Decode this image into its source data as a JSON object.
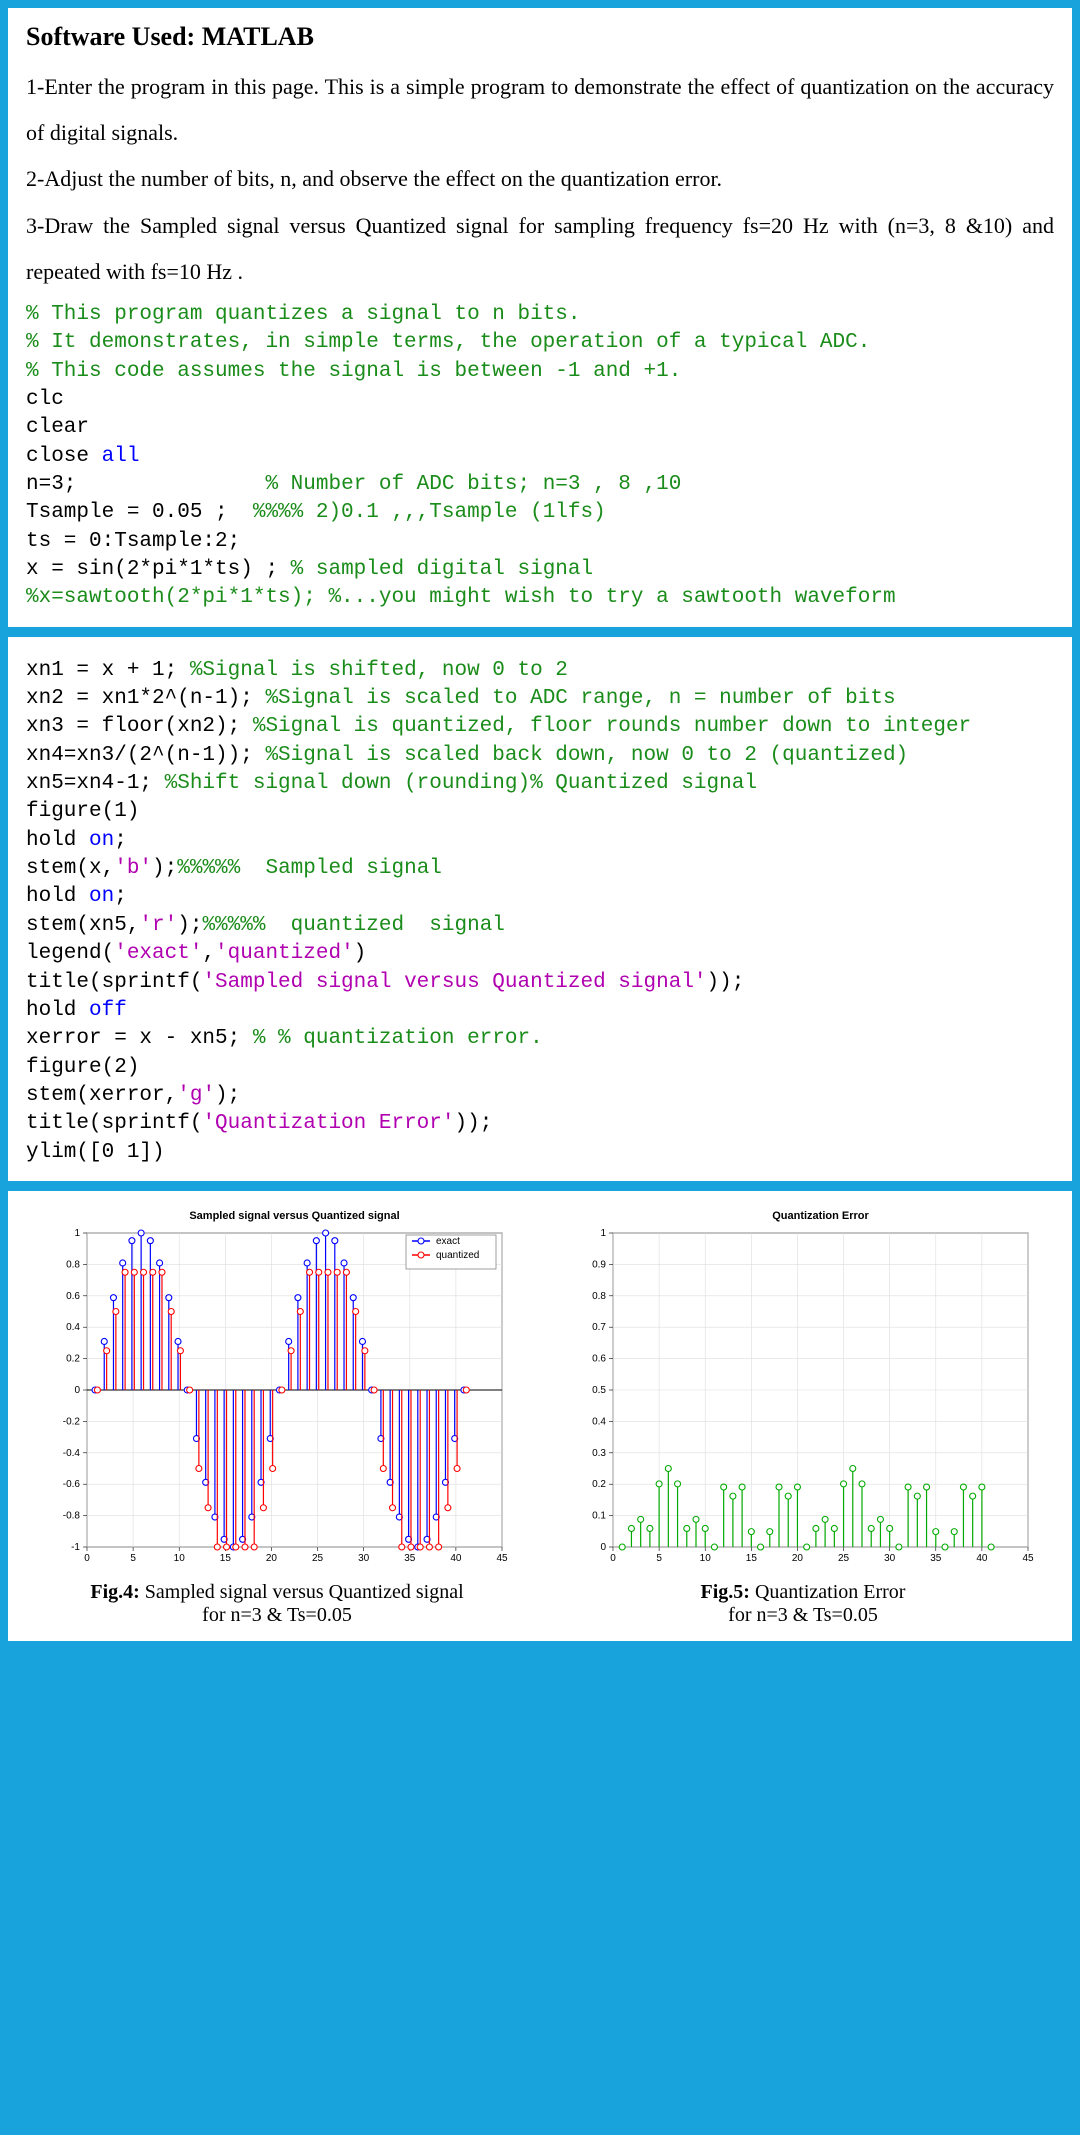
{
  "header": {
    "title": "Software Used: MATLAB"
  },
  "instructions": {
    "p1": "1-Enter the program in this page. This is a simple program to demonstrate  the effect of quantization on the accuracy of digital signals.",
    "p2": " 2-Adjust the number of bits, n, and observe the effect on the quantization error.",
    "p3": "3-Draw the Sampled signal versus Quantized signal for sampling frequency fs=20 Hz with (n=3, 8 &10) and repeated with fs=10 Hz ."
  },
  "code1": [
    {
      "t": "g",
      "s": "% This program quantizes a signal to n bits."
    },
    {
      "t": "g",
      "s": "% It demonstrates, in simple terms, the operation of a typical ADC."
    },
    {
      "t": "g",
      "s": "% This code assumes the signal is between -1 and +1."
    },
    {
      "t": "k",
      "s": "clc"
    },
    {
      "t": "k",
      "s": "clear"
    },
    {
      "t": "mix",
      "parts": [
        {
          "t": "k",
          "s": "close "
        },
        {
          "t": "b",
          "s": "all"
        }
      ]
    },
    {
      "t": "mix",
      "parts": [
        {
          "t": "k",
          "s": "n=3;               "
        },
        {
          "t": "g",
          "s": "% Number of ADC bits; n=3 , 8 ,10"
        }
      ]
    },
    {
      "t": "mix",
      "parts": [
        {
          "t": "k",
          "s": "Tsample = 0.05 ;  "
        },
        {
          "t": "g",
          "s": "%%%% 2)0.1 ,,,Tsample (1lfs)"
        }
      ]
    },
    {
      "t": "k",
      "s": "ts = 0:Tsample:2;"
    },
    {
      "t": "mix",
      "parts": [
        {
          "t": "k",
          "s": "x = sin(2*pi*1*ts) ; "
        },
        {
          "t": "g",
          "s": "% sampled digital signal"
        }
      ]
    },
    {
      "t": "g",
      "s": "%x=sawtooth(2*pi*1*ts); %...you might wish to try a sawtooth waveform"
    }
  ],
  "code2": [
    {
      "t": "mix",
      "parts": [
        {
          "t": "k",
          "s": "xn1 = x + 1; "
        },
        {
          "t": "g",
          "s": "%Signal is shifted, now 0 to 2"
        }
      ]
    },
    {
      "t": "mix",
      "parts": [
        {
          "t": "k",
          "s": "xn2 = xn1*2^(n-1); "
        },
        {
          "t": "g",
          "s": "%Signal is scaled to ADC range, n = number of bits"
        }
      ]
    },
    {
      "t": "mix",
      "parts": [
        {
          "t": "k",
          "s": "xn3 = floor(xn2); "
        },
        {
          "t": "g",
          "s": "%Signal is quantized, floor rounds number down to integer"
        }
      ]
    },
    {
      "t": "mix",
      "parts": [
        {
          "t": "k",
          "s": "xn4=xn3/(2^(n-1)); "
        },
        {
          "t": "g",
          "s": "%Signal is scaled back down, now 0 to 2 (quantized)"
        }
      ]
    },
    {
      "t": "mix",
      "parts": [
        {
          "t": "k",
          "s": "xn5=xn4-1; "
        },
        {
          "t": "g",
          "s": "%Shift signal down (rounding)% Quantized signal"
        }
      ]
    },
    {
      "t": "k",
      "s": "figure(1)"
    },
    {
      "t": "mix",
      "parts": [
        {
          "t": "k",
          "s": "hold "
        },
        {
          "t": "b",
          "s": "on"
        },
        {
          "t": "k",
          "s": ";"
        }
      ]
    },
    {
      "t": "mix",
      "parts": [
        {
          "t": "k",
          "s": "stem(x,"
        },
        {
          "t": "p",
          "s": "'b'"
        },
        {
          "t": "k",
          "s": ");"
        },
        {
          "t": "g",
          "s": "%%%%%  Sampled signal"
        }
      ]
    },
    {
      "t": "mix",
      "parts": [
        {
          "t": "k",
          "s": "hold "
        },
        {
          "t": "b",
          "s": "on"
        },
        {
          "t": "k",
          "s": ";"
        }
      ]
    },
    {
      "t": "mix",
      "parts": [
        {
          "t": "k",
          "s": "stem(xn5,"
        },
        {
          "t": "p",
          "s": "'r'"
        },
        {
          "t": "k",
          "s": ");"
        },
        {
          "t": "g",
          "s": "%%%%%  quantized  signal"
        }
      ]
    },
    {
      "t": "mix",
      "parts": [
        {
          "t": "k",
          "s": "legend("
        },
        {
          "t": "p",
          "s": "'exact'"
        },
        {
          "t": "k",
          "s": ","
        },
        {
          "t": "p",
          "s": "'quantized'"
        },
        {
          "t": "k",
          "s": ")"
        }
      ]
    },
    {
      "t": "mix",
      "parts": [
        {
          "t": "k",
          "s": "title(sprintf("
        },
        {
          "t": "p",
          "s": "'Sampled signal versus Quantized signal'"
        },
        {
          "t": "k",
          "s": "));"
        }
      ]
    },
    {
      "t": "mix",
      "parts": [
        {
          "t": "k",
          "s": "hold "
        },
        {
          "t": "b",
          "s": "off"
        }
      ]
    },
    {
      "t": "mix",
      "parts": [
        {
          "t": "k",
          "s": "xerror = x - xn5; "
        },
        {
          "t": "g",
          "s": "% % quantization error."
        }
      ]
    },
    {
      "t": "k",
      "s": "figure(2)"
    },
    {
      "t": "mix",
      "parts": [
        {
          "t": "k",
          "s": "stem(xerror,"
        },
        {
          "t": "p",
          "s": "'g'"
        },
        {
          "t": "k",
          "s": ");"
        }
      ]
    },
    {
      "t": "mix",
      "parts": [
        {
          "t": "k",
          "s": "title(sprintf("
        },
        {
          "t": "p",
          "s": "'Quantization Error'"
        },
        {
          "t": "k",
          "s": "));"
        }
      ]
    },
    {
      "t": "k",
      "s": "ylim([0 1])"
    }
  ],
  "fig4": {
    "caption_bold": "Fig.4:",
    "caption": " Sampled signal versus Quantized signal",
    "caption_sub": "for n=3 & Ts=0.05"
  },
  "fig5": {
    "caption_bold": "Fig.5:",
    "caption": " Quantization Error",
    "caption_sub": "for n=3 & Ts=0.05"
  },
  "chart_data": [
    {
      "id": "fig4",
      "type": "stem",
      "title": "Sampled signal versus Quantized signal",
      "xlabel": "",
      "ylabel": "",
      "xlim": [
        0,
        45
      ],
      "ylim": [
        -1,
        1
      ],
      "xticks": [
        0,
        5,
        10,
        15,
        20,
        25,
        30,
        35,
        40,
        45
      ],
      "yticks": [
        -1,
        -0.8,
        -0.6,
        -0.4,
        -0.2,
        0,
        0.2,
        0.4,
        0.6,
        0.8,
        1
      ],
      "legend": [
        "exact",
        "quantized"
      ],
      "x": [
        1,
        2,
        3,
        4,
        5,
        6,
        7,
        8,
        9,
        10,
        11,
        12,
        13,
        14,
        15,
        16,
        17,
        18,
        19,
        20,
        21,
        22,
        23,
        24,
        25,
        26,
        27,
        28,
        29,
        30,
        31,
        32,
        33,
        34,
        35,
        36,
        37,
        38,
        39,
        40,
        41
      ],
      "series": [
        {
          "name": "exact",
          "color": "#0000ff",
          "values": [
            0,
            0.309,
            0.588,
            0.809,
            0.951,
            1,
            0.951,
            0.809,
            0.588,
            0.309,
            0,
            -0.309,
            -0.588,
            -0.809,
            -0.951,
            -1,
            -0.951,
            -0.809,
            -0.588,
            -0.309,
            0,
            0.309,
            0.588,
            0.809,
            0.951,
            1,
            0.951,
            0.809,
            0.588,
            0.309,
            0,
            -0.309,
            -0.588,
            -0.809,
            -0.951,
            -1,
            -0.951,
            -0.809,
            -0.588,
            -0.309,
            0
          ]
        },
        {
          "name": "quantized",
          "color": "#ff0000",
          "values": [
            0,
            0.25,
            0.5,
            0.75,
            0.75,
            0.75,
            0.75,
            0.75,
            0.5,
            0.25,
            0,
            -0.5,
            -0.75,
            -1,
            -1,
            -1,
            -1,
            -1,
            -0.75,
            -0.5,
            0,
            0.25,
            0.5,
            0.75,
            0.75,
            0.75,
            0.75,
            0.75,
            0.5,
            0.25,
            0,
            -0.5,
            -0.75,
            -1,
            -1,
            -1,
            -1,
            -1,
            -0.75,
            -0.5,
            0
          ]
        }
      ]
    },
    {
      "id": "fig5",
      "type": "stem",
      "title": "Quantization Error",
      "xlabel": "",
      "ylabel": "",
      "xlim": [
        0,
        45
      ],
      "ylim": [
        0,
        1
      ],
      "xticks": [
        0,
        5,
        10,
        15,
        20,
        25,
        30,
        35,
        40,
        45
      ],
      "yticks": [
        0,
        0.1,
        0.2,
        0.3,
        0.4,
        0.5,
        0.6,
        0.7,
        0.8,
        0.9,
        1
      ],
      "x": [
        1,
        2,
        3,
        4,
        5,
        6,
        7,
        8,
        9,
        10,
        11,
        12,
        13,
        14,
        15,
        16,
        17,
        18,
        19,
        20,
        21,
        22,
        23,
        24,
        25,
        26,
        27,
        28,
        29,
        30,
        31,
        32,
        33,
        34,
        35,
        36,
        37,
        38,
        39,
        40,
        41
      ],
      "series": [
        {
          "name": "error",
          "color": "#00aa00",
          "values": [
            0,
            0.059,
            0.088,
            0.059,
            0.201,
            0.25,
            0.201,
            0.059,
            0.088,
            0.059,
            0,
            0.191,
            0.162,
            0.191,
            0.049,
            0,
            0.049,
            0.191,
            0.162,
            0.191,
            0,
            0.059,
            0.088,
            0.059,
            0.201,
            0.25,
            0.201,
            0.059,
            0.088,
            0.059,
            0,
            0.191,
            0.162,
            0.191,
            0.049,
            0,
            0.049,
            0.191,
            0.162,
            0.191,
            0
          ]
        }
      ]
    }
  ]
}
